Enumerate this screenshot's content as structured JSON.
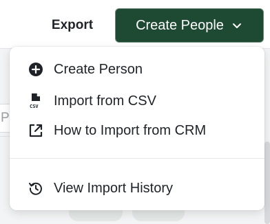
{
  "toolbar": {
    "export_label": "Export",
    "create_label": "Create People",
    "create_bg": "#1e4a33"
  },
  "background": {
    "input_partial_text": "P"
  },
  "menu": {
    "items": [
      {
        "label": "Create Person",
        "icon": "plus-circle-icon"
      },
      {
        "label": "Import from CSV",
        "icon": "csv-file-icon"
      },
      {
        "label": "How to Import from CRM",
        "icon": "external-link-icon"
      },
      {
        "label": "View Import History",
        "icon": "history-icon"
      }
    ]
  }
}
